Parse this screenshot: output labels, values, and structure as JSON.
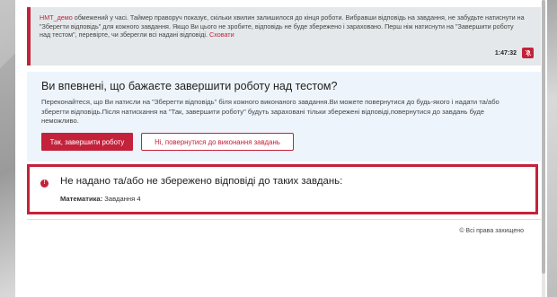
{
  "notice": {
    "course_name": "НМТ_демо",
    "text": " обмежений у часі. Таймер праворуч показує, скільки хвилин залишилося до кінця роботи. Вибравши відповідь на завдання, не забудьте натиснути на \"Зберегти відповідь\" для кожного завдання. Якщо Ви цього не зробите, відповідь не буде збережено і зараховано. Перш ніж натиснути на \"Завершити роботу над тестом\", перевірте, чи зберегли всі надані відповіді. ",
    "hide_link": "Сховати",
    "timer": "1:47:32",
    "bell_icon": "bell-slash-icon"
  },
  "confirm": {
    "title": "Ви впевнені, що бажаєте завершити роботу над тестом?",
    "body": "Переконайтеся, що Ви натисли на \"Зберегти відповідь\" біля кожного виконаного завдання.Ви можете повернутися до будь-якого і надати та/або зберегти відповідь.Після натискання на \"Так, завершити роботу\" будуть зараховані тільки збережені відповіді,повернутися до завдань буде неможливо.",
    "yes_button": "Так, завершити роботу",
    "no_button": "Ні, повернутися до виконання завдань"
  },
  "warning": {
    "title": "Не надано та/або не збережено відповіді до таких завдань:",
    "subject": "Математика:",
    "tasks": "Завдання 4",
    "icon": "!"
  },
  "footer": {
    "copyright": "© Всі права захищено"
  },
  "colors": {
    "accent": "#c3223a",
    "notice_bg": "#e4e8ea",
    "confirm_bg": "#eef4fb"
  }
}
